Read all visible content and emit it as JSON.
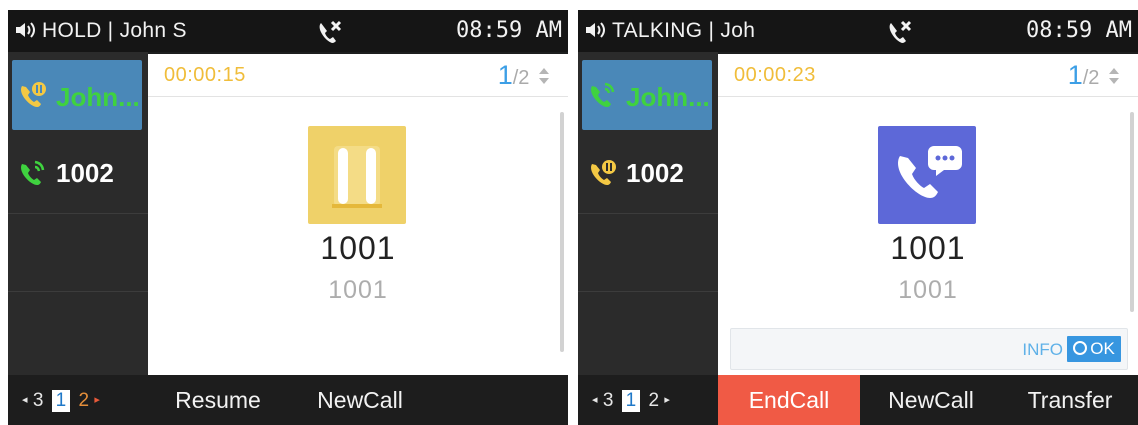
{
  "screens": [
    {
      "status": {
        "text": "HOLD | John S",
        "time": "08:59 AM"
      },
      "lines": [
        {
          "label": "John...",
          "color": "#3fd23f",
          "icon": "phone-hold-icon"
        },
        {
          "label": "1002",
          "color": "#ffffff",
          "icon": "phone-call-icon"
        }
      ],
      "call": {
        "timer": "00:00:15",
        "page_current": "1",
        "page_total": "/2",
        "name": "1001",
        "number": "1001",
        "badge_color": "#efd169",
        "badge_icon": "hold-pause-icon"
      },
      "pager": {
        "prev": "3",
        "current": "1",
        "next": "2"
      },
      "softkeys": [
        "Resume",
        "NewCall"
      ]
    },
    {
      "status": {
        "text": "TALKING | Joh",
        "time": "08:59 AM"
      },
      "lines": [
        {
          "label": "John...",
          "color": "#3fd23f",
          "icon": "phone-call-icon"
        },
        {
          "label": "1002",
          "color": "#ffffff",
          "icon": "phone-hold-icon"
        }
      ],
      "call": {
        "timer": "00:00:23",
        "page_current": "1",
        "page_total": "/2",
        "name": "1001",
        "number": "1001",
        "badge_color": "#5d68d8",
        "badge_icon": "phone-talking-icon"
      },
      "info": {
        "label": "INFO",
        "ok": "OK"
      },
      "pager": {
        "prev": "3",
        "current": "1",
        "next": "2"
      },
      "softkeys": [
        "EndCall",
        "NewCall",
        "Transfer"
      ]
    }
  ]
}
